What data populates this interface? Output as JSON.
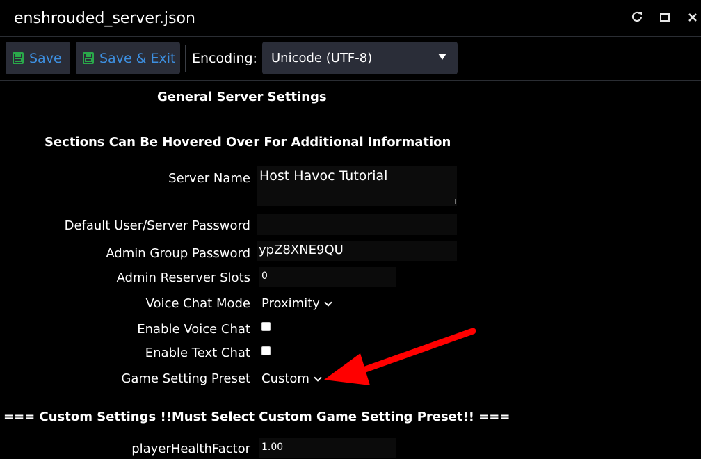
{
  "window": {
    "title": "enshrouded_server.json",
    "refresh_icon": "refresh-icon",
    "maximize_icon": "maximize-icon",
    "close_icon": "close-icon"
  },
  "toolbar": {
    "save_label": "Save",
    "save_exit_label": "Save & Exit",
    "encoding_label": "Encoding:",
    "encoding_value": "Unicode (UTF-8)"
  },
  "form": {
    "general_heading": "General Server Settings",
    "hover_heading": "Sections Can Be Hovered Over For Additional Information",
    "server_name": {
      "label": "Server Name",
      "value": "Host Havoc Tutorial"
    },
    "default_password": {
      "label": "Default User/Server Password",
      "value": ""
    },
    "admin_password": {
      "label": "Admin Group Password",
      "value": "ypZ8XNE9QU"
    },
    "admin_slots": {
      "label": "Admin Reserver Slots",
      "value": "0"
    },
    "voice_chat_mode": {
      "label": "Voice Chat Mode",
      "value": "Proximity"
    },
    "enable_voice_chat": {
      "label": "Enable Voice Chat",
      "checked": false
    },
    "enable_text_chat": {
      "label": "Enable Text Chat",
      "checked": false
    },
    "game_preset": {
      "label": "Game Setting Preset",
      "value": "Custom"
    },
    "custom_heading": "=== Custom Settings !!Must Select Custom Game Setting Preset!! ===",
    "player_health": {
      "label": "playerHealthFactor",
      "value": "1.00"
    }
  },
  "annotation": {
    "arrow_color": "#ff0000"
  }
}
